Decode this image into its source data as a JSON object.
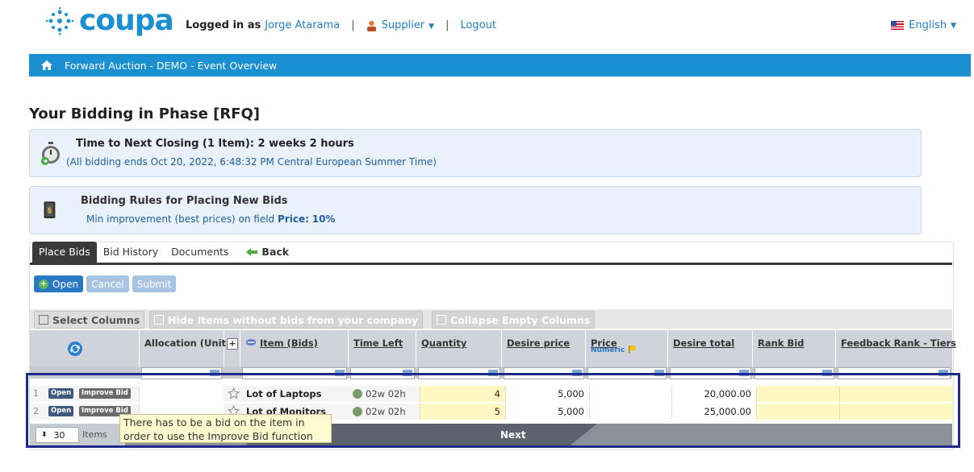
{
  "header": {
    "logo_text": "coupa",
    "logged_in_label": "Logged in as",
    "user_name": "Jorge Atarama",
    "role_menu": "Supplier",
    "logout": "Logout",
    "language": "English"
  },
  "breadcrumb": {
    "title": "Forward Auction - DEMO - Event Overview"
  },
  "page_title": "Your Bidding in Phase [RFQ]",
  "closing_panel": {
    "heading": "Time to Next Closing (1 Item):  2 weeks 2 hours",
    "subtext": "(All bidding ends Oct 20, 2022, 6:48:32 PM Central European Summer Time)"
  },
  "rules_panel": {
    "heading": "Bidding Rules for Placing New Bids",
    "subtext_prefix": "Min improvement (best prices) on field",
    "field": "Price:",
    "value": "10%"
  },
  "tabs": {
    "place_bids": "Place Bids",
    "bid_history": "Bid History",
    "documents": "Documents",
    "back": "Back"
  },
  "actions": {
    "open": "Open",
    "cancel": "Cancel",
    "submit": "Submit"
  },
  "chooser": {
    "select_columns": "Select Columns",
    "hide_items": "Hide Items without bids from your company",
    "collapse_empty": "Collapse Empty Columns"
  },
  "columns": {
    "allocation": "Allocation (Unit)",
    "item": "Item (Bids)",
    "time_left": "Time Left",
    "quantity": "Quantity",
    "desire_price": "Desire price",
    "price": "Price",
    "price_sub": "Numeric",
    "desire_total": "Desire total",
    "rank_bid": "Rank Bid",
    "feedback_rank": "Feedback Rank - Tiers"
  },
  "rows": [
    {
      "num": "1",
      "open": "Open",
      "improve": "Improve Bid",
      "item": "Lot of Laptops",
      "time_left": "02w 02h",
      "quantity": "4",
      "desire_price": "5,000",
      "desire_total": "20,000.00"
    },
    {
      "num": "2",
      "open": "Open",
      "improve": "Improve Bid",
      "item": "Lot of Monitors",
      "time_left": "02w 02h",
      "quantity": "5",
      "desire_price": "5,000",
      "desire_total": "25,000.00"
    }
  ],
  "pager": {
    "per_page": "30",
    "items_label": "Items",
    "next": "Next"
  },
  "tooltip": "There has to be a bid on the item in order to use the Improve Bid function",
  "colors": {
    "brand_blue": "#1a8fd2",
    "highlight_frame": "#1c2b8c",
    "tooltip_bg": "#fffbd0"
  }
}
